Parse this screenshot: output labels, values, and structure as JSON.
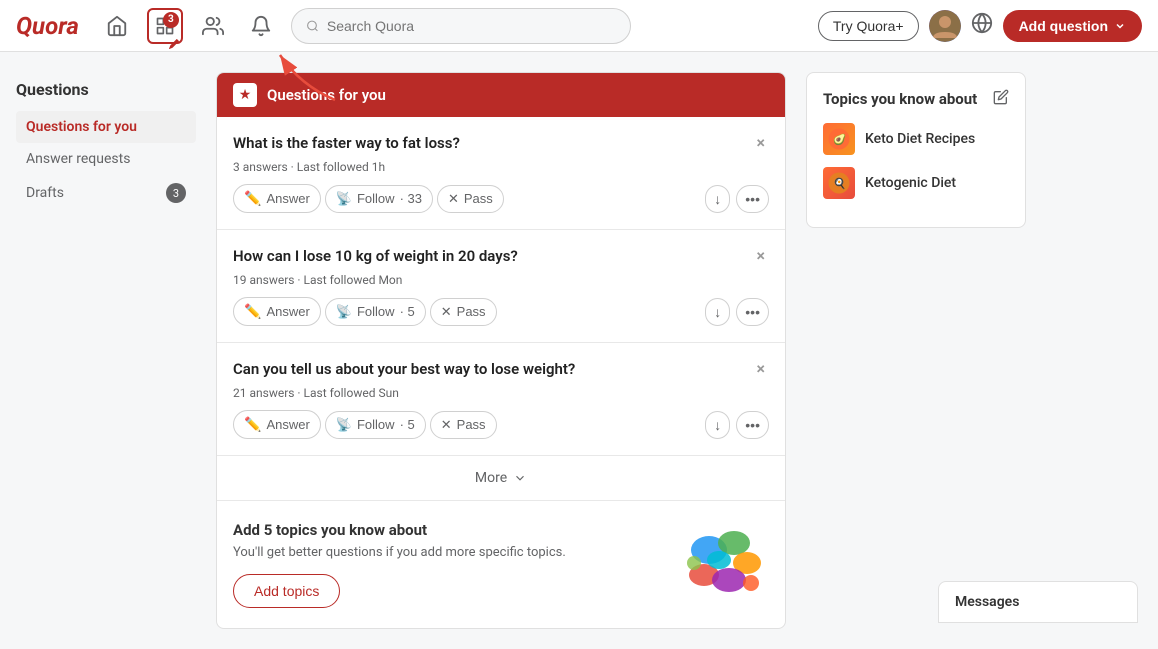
{
  "header": {
    "logo": "Quora",
    "search_placeholder": "Search Quora",
    "try_plus_label": "Try Quora+",
    "add_question_label": "Add question",
    "nav_badge": "3"
  },
  "sidebar": {
    "section_title": "Questions",
    "items": [
      {
        "label": "Questions for you",
        "active": true,
        "badge": null
      },
      {
        "label": "Answer requests",
        "active": false,
        "badge": null
      },
      {
        "label": "Drafts",
        "active": false,
        "badge": "3"
      }
    ]
  },
  "panel": {
    "header_title": "Questions for you",
    "questions": [
      {
        "title": "What is the faster way to fat loss?",
        "meta": "3 answers · Last followed 1h",
        "follow_count": "33",
        "id": "q1"
      },
      {
        "title": "How can I lose 10 kg of weight in 20 days?",
        "meta": "19 answers · Last followed Mon",
        "follow_count": "5",
        "id": "q2"
      },
      {
        "title": "Can you tell us about your best way to lose weight?",
        "meta": "21 answers · Last followed Sun",
        "follow_count": "5",
        "id": "q3"
      }
    ],
    "actions": {
      "answer": "Answer",
      "follow": "Follow",
      "pass": "Pass"
    },
    "more_label": "More",
    "add_topics": {
      "title": "Add 5 topics you know about",
      "description": "You'll get better questions if you add more specific topics.",
      "button_label": "Add topics"
    }
  },
  "right_panel": {
    "title": "Topics you know about",
    "topics": [
      {
        "name": "Keto Diet Recipes"
      },
      {
        "name": "Ketogenic Diet"
      }
    ]
  },
  "messages": {
    "label": "Messages"
  }
}
